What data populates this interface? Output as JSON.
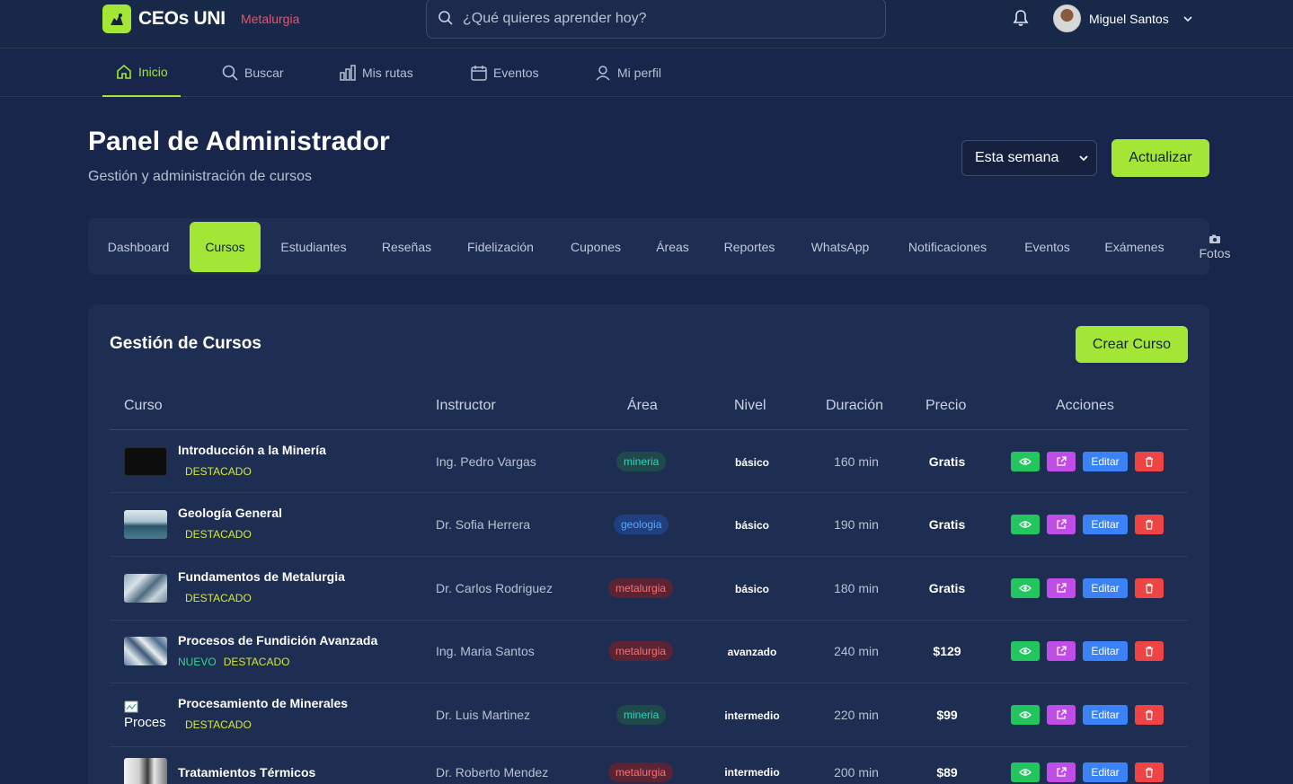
{
  "brand": {
    "name": "CEOs UNI",
    "subtitle": "Metalurgia"
  },
  "search": {
    "placeholder": "¿Qué quieres aprender hoy?"
  },
  "user": {
    "name": "Miguel Santos"
  },
  "nav": [
    {
      "label": "Inicio",
      "icon": "home-icon",
      "active": true
    },
    {
      "label": "Buscar",
      "icon": "search-icon"
    },
    {
      "label": "Mis rutas",
      "icon": "chart-bars-icon"
    },
    {
      "label": "Eventos",
      "icon": "calendar-icon"
    },
    {
      "label": "Mi perfil",
      "icon": "user-icon"
    }
  ],
  "header": {
    "title": "Panel de Administrador",
    "subtitle": "Gestión y administración de cursos",
    "period": "Esta semana",
    "refresh": "Actualizar"
  },
  "tabs": [
    "Dashboard",
    "Cursos",
    "Estudiantes",
    "Reseñas",
    "Fidelización",
    "Cupones",
    "Áreas",
    "Reportes",
    "WhatsApp",
    "Notificaciones",
    "Eventos",
    "Exámenes",
    "Fotos"
  ],
  "active_tab": "Cursos",
  "courses_panel": {
    "title": "Gestión de Cursos",
    "create": "Crear Curso",
    "columns": {
      "course": "Curso",
      "instructor": "Instructor",
      "area": "Área",
      "level": "Nivel",
      "duration": "Duración",
      "price": "Precio",
      "actions": "Acciones"
    },
    "edit_label": "Editar",
    "rows": [
      {
        "name": "Introducción a la Minería",
        "tags": [
          "DESTACADO"
        ],
        "instructor": "Ing. Pedro Vargas",
        "area": "mineria",
        "level": "básico",
        "duration": "160 min",
        "price": "Gratis"
      },
      {
        "name": "Geología General",
        "tags": [
          "DESTACADO"
        ],
        "instructor": "Dr. Sofia Herrera",
        "area": "geologia",
        "level": "básico",
        "duration": "190 min",
        "price": "Gratis"
      },
      {
        "name": "Fundamentos de Metalurgia",
        "tags": [
          "DESTACADO"
        ],
        "instructor": "Dr. Carlos Rodriguez",
        "area": "metalurgia",
        "level": "básico",
        "duration": "180 min",
        "price": "Gratis"
      },
      {
        "name": "Procesos de Fundición Avanzada",
        "tags": [
          "NUEVO",
          "DESTACADO"
        ],
        "instructor": "Ing. Maria Santos",
        "area": "metalurgia",
        "level": "avanzado",
        "duration": "240 min",
        "price": "$129"
      },
      {
        "name": "Procesamiento de Minerales",
        "tags": [
          "DESTACADO"
        ],
        "instructor": "Dr. Luis Martinez",
        "area": "mineria",
        "level": "intermedio",
        "duration": "220 min",
        "price": "$99",
        "thumb_alt": "Proces"
      },
      {
        "name": "Tratamientos Térmicos",
        "tags": [],
        "instructor": "Dr. Roberto Mendez",
        "area": "metalurgia",
        "level": "intermedio",
        "duration": "200 min",
        "price": "$89"
      }
    ]
  },
  "colors": {
    "accent": "#a3e635",
    "background": "#17264a",
    "panel": "#1e2d52",
    "view": "#22c55e",
    "open": "#c04de8",
    "edit": "#3b82f6",
    "delete": "#ef4444"
  }
}
